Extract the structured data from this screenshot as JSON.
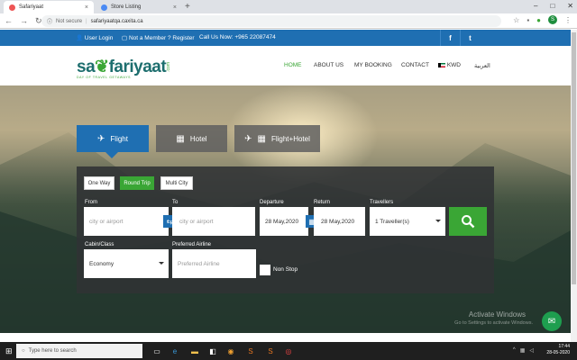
{
  "browser": {
    "tabs": [
      {
        "title": "Safariyaat",
        "active": true
      },
      {
        "title": "Store Listing",
        "active": false
      }
    ],
    "security": "Not secure",
    "url": "safariyaatqa.caxita.ca",
    "profile_initial": "S"
  },
  "topbar": {
    "user_login": "User Login",
    "register": "Not a Member ? Register",
    "call": "Call Us Now: +965 22087474",
    "facebook": "f",
    "twitter": "t"
  },
  "brand": {
    "logo_part1": "sa",
    "logo_part2": "fariyaat",
    "logo_com": ".com",
    "tagline": "DAY OF TRAVEL GETAWAYS"
  },
  "nav": {
    "home": "HOME",
    "about": "ABOUT US",
    "booking": "MY BOOKING",
    "contact": "CONTACT",
    "currency": "KWD",
    "arabic": "العربية"
  },
  "product_tabs": {
    "flight": "Flight",
    "hotel": "Hotel",
    "flight_hotel": "Flight+Hotel"
  },
  "trip_types": {
    "one_way": "One Way",
    "round_trip": "Round Trip",
    "multi_city": "Multi City",
    "selected": "Round Trip"
  },
  "form": {
    "from_label": "From",
    "from_placeholder": "city or airport",
    "to_label": "To",
    "to_placeholder": "city or airport",
    "departure_label": "Departure",
    "departure_value": "28 May,2020",
    "return_label": "Return",
    "return_value": "28 May,2020",
    "travellers_label": "Travellers",
    "travellers_value": "1 Traveller(s)",
    "cabin_label": "Cabin/Class",
    "cabin_value": "Economy",
    "airline_label": "Preferred Airline",
    "airline_placeholder": "Preferred Airline",
    "nonstop_label": "Non Stop"
  },
  "watermark": {
    "line1": "Activate Windows",
    "line2": "Go to Settings to activate Windows."
  },
  "taskbar": {
    "search_placeholder": "Type here to search",
    "time": "17:44",
    "date": "28-05-2020"
  },
  "colors": {
    "primary_blue": "#1f6fb2",
    "accent_green": "#3aa635"
  }
}
